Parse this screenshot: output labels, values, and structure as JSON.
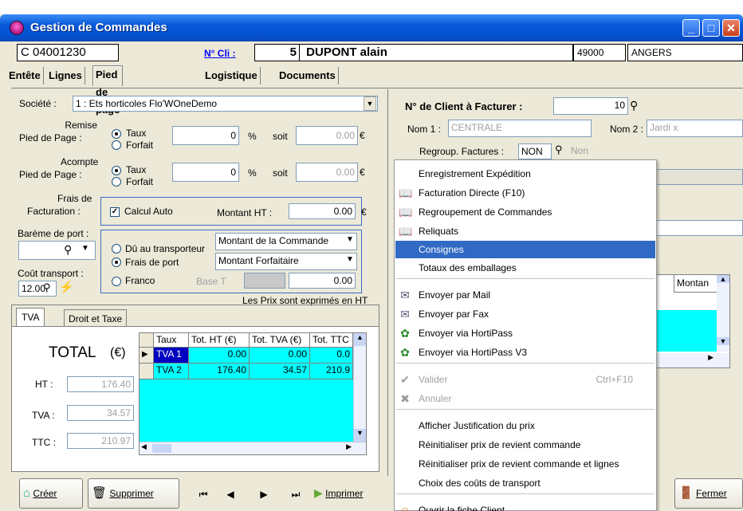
{
  "window": {
    "title": "Gestion de Commandes"
  },
  "header": {
    "order_no": "C 04001230",
    "client_link": "N° Cli :",
    "client_no": "5",
    "client_name": "DUPONT alain",
    "postcode": "49000",
    "city": "ANGERS"
  },
  "tabs": [
    "Entête",
    "Lignes",
    "Pied de page",
    "Logistique",
    "Documents"
  ],
  "left": {
    "societe_label": "Société :",
    "societe_value": "1 : Ets horticoles Flo'WOneDemo",
    "remise_label_1": "Remise",
    "remise_label_2": "Pied de Page :",
    "acompte_label_1": "Acompte",
    "acompte_label_2": "Pied de Page :",
    "taux": "Taux",
    "forfait": "Forfait",
    "remise_value": "0",
    "acompte_value": "0",
    "pct": "%",
    "soit": "soit",
    "remise_amount": "0.00",
    "acompte_amount": "0.00",
    "euro": "€",
    "frais_label_1": "Frais de",
    "frais_label_2": "Facturation :",
    "calcul_auto": "Calcul Auto",
    "montant_ht_label": "Montant HT :",
    "montant_ht_value": "0.00",
    "bareme_label": "Barème de port :",
    "cout_label": "Coût transport :",
    "cout_value": "12.00",
    "du_transporteur": "Dû au transporteur",
    "frais_de_port": "Frais de port",
    "franco": "Franco",
    "mode_1": "Montant de la Commande",
    "mode_2": "Montant Forfaitaire",
    "base_label": "Base T",
    "base_value": "0.00",
    "note": "Les Prix sont exprimés en HT"
  },
  "tva_tabs": [
    "TVA",
    "Droit et Taxe"
  ],
  "totals": {
    "title": "TOTAL",
    "unit": "(€)",
    "ht_label": "HT :",
    "ht_value": "176.40",
    "tva_label": "TVA :",
    "tva_value": "34.57",
    "ttc_label": "TTC :",
    "ttc_value": "210.97"
  },
  "tva_grid": {
    "columns": [
      "Taux",
      "Tot. HT (€)",
      "Tot. TVA (€)",
      "Tot. TTC ("
    ],
    "rows": [
      [
        "TVA 1",
        "0.00",
        "0.00",
        "0.0"
      ],
      [
        "TVA 2",
        "176.40",
        "34.57",
        "210.9"
      ]
    ]
  },
  "right": {
    "client_facturer_label": "N° de Client à Facturer :",
    "client_facturer_value": "10",
    "nom1_label": "Nom 1 :",
    "nom1_value": "CENTRALE",
    "nom2_label": "Nom 2 :",
    "nom2_value": "Jardi x",
    "regroup_label": "Regroup. Factures :",
    "regroup_value": "NON",
    "regroup_text": "Non",
    "grid_col": "Montan"
  },
  "menu": {
    "items": [
      {
        "label": "Enregistrement Expédition",
        "icon": "",
        "shortcut": "",
        "state": "normal"
      },
      {
        "label": "Facturation Directe (F10)",
        "icon": "book-icon",
        "shortcut": "",
        "state": "normal"
      },
      {
        "label": "Regroupement de Commandes",
        "icon": "book-icon",
        "shortcut": "",
        "state": "normal"
      },
      {
        "label": "Reliquats",
        "icon": "book-icon",
        "shortcut": "",
        "state": "normal"
      },
      {
        "label": "Consignes",
        "icon": "",
        "shortcut": "",
        "state": "selected"
      },
      {
        "label": "Totaux des emballages",
        "icon": "",
        "shortcut": "",
        "state": "normal"
      },
      {
        "label": "Envoyer par Mail",
        "icon": "send-icon",
        "shortcut": "",
        "state": "normal"
      },
      {
        "label": "Envoyer par Fax",
        "icon": "send-icon",
        "shortcut": "",
        "state": "normal"
      },
      {
        "label": "Envoyer via HortiPass",
        "icon": "hortipass-icon",
        "shortcut": "",
        "state": "normal"
      },
      {
        "label": "Envoyer via HortiPass V3",
        "icon": "hortipass-icon",
        "shortcut": "",
        "state": "normal"
      },
      {
        "label": "Valider",
        "icon": "check-icon",
        "shortcut": "Ctrl+F10",
        "state": "disabled"
      },
      {
        "label": "Annuler",
        "icon": "cross-icon",
        "shortcut": "",
        "state": "disabled"
      },
      {
        "label": "Afficher Justification du prix",
        "icon": "",
        "shortcut": "",
        "state": "normal"
      },
      {
        "label": "Réinitialiser prix de revient commande",
        "icon": "",
        "shortcut": "",
        "state": "normal"
      },
      {
        "label": "Réinitialiser prix de revient commande et lignes",
        "icon": "",
        "shortcut": "",
        "state": "normal"
      },
      {
        "label": "Choix des coûts de transport",
        "icon": "",
        "shortcut": "",
        "state": "normal"
      },
      {
        "label": "Ouvrir la fiche Client",
        "icon": "client-icon",
        "shortcut": "",
        "state": "normal"
      }
    ]
  },
  "buttons": {
    "creer": "Créer",
    "supprimer": "Supprimer",
    "imprimer": "Imprimer",
    "fermer": "Fermer"
  }
}
